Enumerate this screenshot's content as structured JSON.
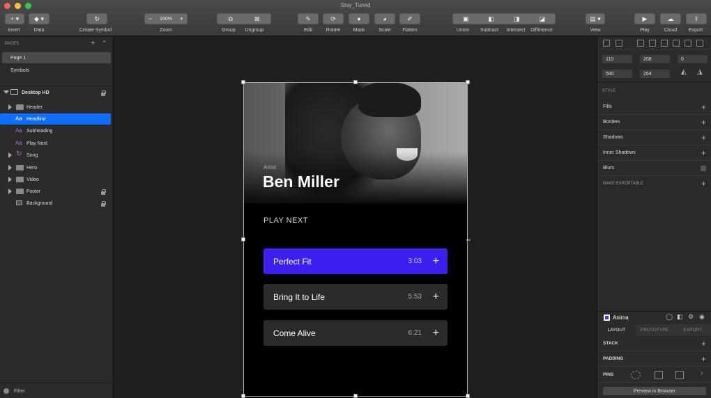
{
  "window": {
    "title": "Stay_Tuned"
  },
  "toolbar": {
    "insert": "Insert",
    "data": "Data",
    "create_symbol": "Create Symbol",
    "zoom_value": "100%",
    "zoom": "Zoom",
    "group": "Group",
    "ungroup": "Ungroup",
    "edit": "Edit",
    "rotate": "Rotate",
    "mask": "Mask",
    "scale": "Scale",
    "flatten": "Flatten",
    "union": "Union",
    "subtract": "Subtract",
    "intersect": "Intersect",
    "difference": "Difference",
    "view": "View",
    "play": "Play",
    "cloud": "Cloud",
    "export": "Export"
  },
  "pages": {
    "header": "PAGES",
    "items": [
      {
        "label": "Page 1"
      },
      {
        "label": "Symbols"
      }
    ]
  },
  "layers": {
    "artboard": "Desktop HD",
    "items": [
      {
        "label": "Header",
        "kind": "group"
      },
      {
        "label": "Headline",
        "kind": "text",
        "selected": true
      },
      {
        "label": "Subheading",
        "kind": "text"
      },
      {
        "label": "Play Next",
        "kind": "text"
      },
      {
        "label": "Song",
        "kind": "symbol"
      },
      {
        "label": "Hero",
        "kind": "group"
      },
      {
        "label": "Video",
        "kind": "group"
      },
      {
        "label": "Footer",
        "kind": "group",
        "locked": true
      },
      {
        "label": "Background",
        "kind": "shape",
        "locked": true
      }
    ],
    "filter": "Filter"
  },
  "artboard": {
    "artist_label": "Artist",
    "artist_name": "Ben Miller",
    "play_next": "PLAY NEXT",
    "songs": [
      {
        "title": "Perfect Fit",
        "time": "3:03",
        "active": true
      },
      {
        "title": "Bring It to Life",
        "time": "5:53",
        "active": false
      },
      {
        "title": "Come Alive",
        "time": "6:21",
        "active": false
      }
    ],
    "plus": "+"
  },
  "inspector": {
    "x": "110",
    "y": "208",
    "rotation": "0",
    "width": "580",
    "height": "264",
    "style": "STYLE",
    "fills": "Fills",
    "borders": "Borders",
    "shadows": "Shadows",
    "inner_shadows": "Inner Shadows",
    "blurs": "Blurs",
    "make_exportable": "MAKE EXPORTABLE",
    "plus": "+"
  },
  "anima": {
    "title": "Anima",
    "tabs": [
      "LAYOUT",
      "PROTOTYPE",
      "EXPORT"
    ],
    "stack": "STACK",
    "padding": "PADDING",
    "pins": "PINS",
    "preview": "Preview in Browser"
  },
  "colors": {
    "accent": "#3d1ff0",
    "selection": "#0d6efd"
  }
}
